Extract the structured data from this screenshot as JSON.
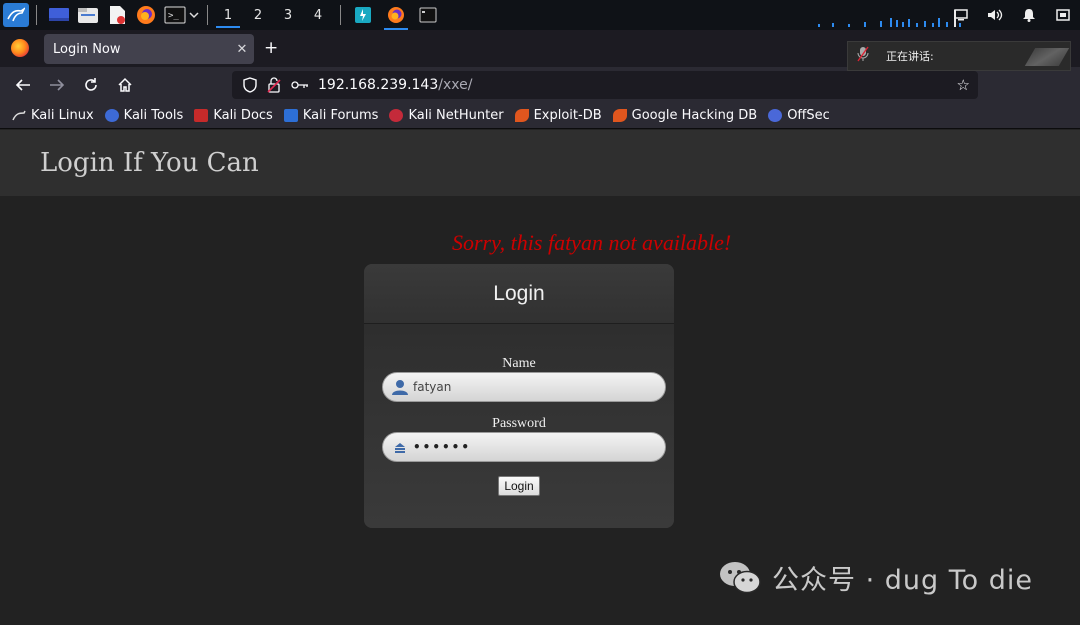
{
  "taskbar": {
    "workspaces": [
      "1",
      "2",
      "3",
      "4"
    ],
    "active_workspace": "1",
    "icons": [
      "kali-menu-icon",
      "desktop-icon",
      "file-manager-icon",
      "text-editor-icon",
      "firefox-icon",
      "terminal-icon",
      "chevron-down-icon",
      "app-icon",
      "firefox-icon",
      "terminal-icon"
    ],
    "tray": [
      "display-icon",
      "volume-icon",
      "bell-icon",
      "lock-icon"
    ],
    "accent_color": "#2d8bf0"
  },
  "browser": {
    "tab_title": "Login Now",
    "new_tab_label": "+",
    "url_host": "192.168.239.143",
    "url_path": "/xxe/",
    "bookmarks": [
      {
        "label": "Kali Linux",
        "icon": "kali-icon"
      },
      {
        "label": "Kali Tools",
        "icon": "kali-tools-icon"
      },
      {
        "label": "Kali Docs",
        "icon": "kali-docs-icon"
      },
      {
        "label": "Kali Forums",
        "icon": "kali-forums-icon"
      },
      {
        "label": "Kali NetHunter",
        "icon": "nethunter-icon"
      },
      {
        "label": "Exploit-DB",
        "icon": "exploit-db-icon"
      },
      {
        "label": "Google Hacking DB",
        "icon": "ghdb-icon"
      },
      {
        "label": "OffSec",
        "icon": "offsec-icon"
      }
    ]
  },
  "notification": {
    "text": "正在讲话:"
  },
  "page": {
    "header_title": "Login If You Can",
    "error_message": "Sorry, this fatyan not available!",
    "error_color": "#cc0000",
    "login_card": {
      "title": "Login",
      "name_label": "Name",
      "name_value": "fatyan",
      "password_label": "Password",
      "password_value": "••••••",
      "button_label": "Login"
    }
  },
  "watermark": {
    "text": "公众号 · dug To die"
  }
}
